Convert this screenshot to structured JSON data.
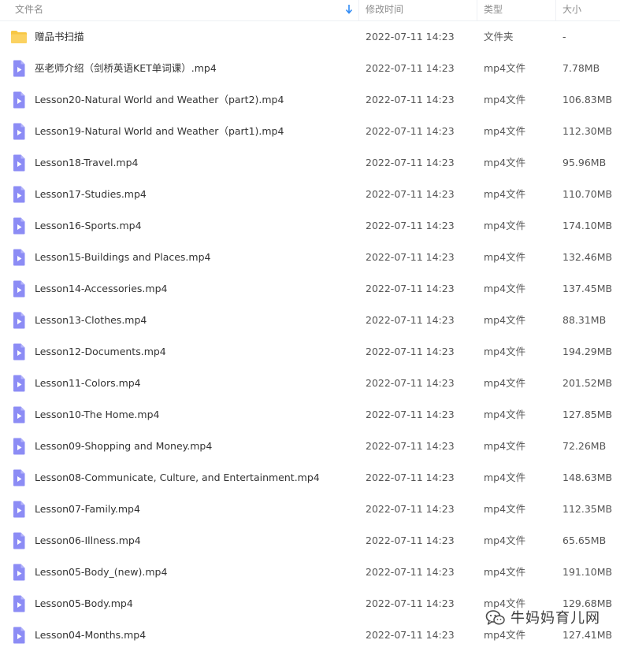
{
  "header": {
    "name_label": "文件名",
    "date_label": "修改时间",
    "type_label": "类型",
    "size_label": "大小"
  },
  "colors": {
    "folder": "#f7c744",
    "video": "#8c8cf5",
    "sort_arrow": "#2f8af5"
  },
  "files": [
    {
      "icon": "folder-icon",
      "name": "赠品书扫描",
      "date": "2022-07-11 14:23",
      "type": "文件夹",
      "size": "-"
    },
    {
      "icon": "video-file-icon",
      "name": "巫老师介绍（剑桥英语KET单词课）.mp4",
      "date": "2022-07-11 14:23",
      "type": "mp4文件",
      "size": "7.78MB"
    },
    {
      "icon": "video-file-icon",
      "name": "Lesson20-Natural World and Weather（part2).mp4",
      "date": "2022-07-11 14:23",
      "type": "mp4文件",
      "size": "106.83MB"
    },
    {
      "icon": "video-file-icon",
      "name": "Lesson19-Natural World and Weather（part1).mp4",
      "date": "2022-07-11 14:23",
      "type": "mp4文件",
      "size": "112.30MB"
    },
    {
      "icon": "video-file-icon",
      "name": "Lesson18-Travel.mp4",
      "date": "2022-07-11 14:23",
      "type": "mp4文件",
      "size": "95.96MB"
    },
    {
      "icon": "video-file-icon",
      "name": "Lesson17-Studies.mp4",
      "date": "2022-07-11 14:23",
      "type": "mp4文件",
      "size": "110.70MB"
    },
    {
      "icon": "video-file-icon",
      "name": "Lesson16-Sports.mp4",
      "date": "2022-07-11 14:23",
      "type": "mp4文件",
      "size": "174.10MB"
    },
    {
      "icon": "video-file-icon",
      "name": "Lesson15-Buildings and Places.mp4",
      "date": "2022-07-11 14:23",
      "type": "mp4文件",
      "size": "132.46MB"
    },
    {
      "icon": "video-file-icon",
      "name": "Lesson14-Accessories.mp4",
      "date": "2022-07-11 14:23",
      "type": "mp4文件",
      "size": "137.45MB"
    },
    {
      "icon": "video-file-icon",
      "name": "Lesson13-Clothes.mp4",
      "date": "2022-07-11 14:23",
      "type": "mp4文件",
      "size": "88.31MB"
    },
    {
      "icon": "video-file-icon",
      "name": "Lesson12-Documents.mp4",
      "date": "2022-07-11 14:23",
      "type": "mp4文件",
      "size": "194.29MB"
    },
    {
      "icon": "video-file-icon",
      "name": "Lesson11-Colors.mp4",
      "date": "2022-07-11 14:23",
      "type": "mp4文件",
      "size": "201.52MB"
    },
    {
      "icon": "video-file-icon",
      "name": "Lesson10-The Home.mp4",
      "date": "2022-07-11 14:23",
      "type": "mp4文件",
      "size": "127.85MB"
    },
    {
      "icon": "video-file-icon",
      "name": "Lesson09-Shopping and Money.mp4",
      "date": "2022-07-11 14:23",
      "type": "mp4文件",
      "size": "72.26MB"
    },
    {
      "icon": "video-file-icon",
      "name": "Lesson08-Communicate, Culture, and Entertainment.mp4",
      "date": "2022-07-11 14:23",
      "type": "mp4文件",
      "size": "148.63MB"
    },
    {
      "icon": "video-file-icon",
      "name": "Lesson07-Family.mp4",
      "date": "2022-07-11 14:23",
      "type": "mp4文件",
      "size": "112.35MB"
    },
    {
      "icon": "video-file-icon",
      "name": "Lesson06-Illness.mp4",
      "date": "2022-07-11 14:23",
      "type": "mp4文件",
      "size": "65.65MB"
    },
    {
      "icon": "video-file-icon",
      "name": "Lesson05-Body_(new).mp4",
      "date": "2022-07-11 14:23",
      "type": "mp4文件",
      "size": "191.10MB"
    },
    {
      "icon": "video-file-icon",
      "name": "Lesson05-Body.mp4",
      "date": "2022-07-11 14:23",
      "type": "mp4文件",
      "size": "129.68MB"
    },
    {
      "icon": "video-file-icon",
      "name": "Lesson04-Months.mp4",
      "date": "2022-07-11 14:23",
      "type": "mp4文件",
      "size": "127.41MB"
    }
  ],
  "watermark": {
    "text": "牛妈妈育儿网",
    "icon": "wechat-icon"
  }
}
